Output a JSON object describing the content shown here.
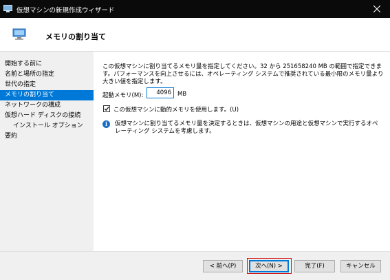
{
  "window": {
    "title": "仮想マシンの新規作成ウィザード"
  },
  "header": {
    "title": "メモリの割り当て"
  },
  "sidebar": {
    "items": [
      {
        "label": "開始する前に"
      },
      {
        "label": "名前と場所の指定"
      },
      {
        "label": "世代の指定"
      },
      {
        "label": "メモリの割り当て",
        "active": true
      },
      {
        "label": "ネットワークの構成"
      },
      {
        "label": "仮想ハード ディスクの接続"
      },
      {
        "label": "インストール オプション",
        "sub": true
      },
      {
        "label": "要約"
      }
    ]
  },
  "main": {
    "description": "この仮想マシンに割り当てるメモリ量を指定してください。32 から 251658240 MB の範囲で指定できます。パフォーマンスを向上させるには、オペレーティング システムで推奨されている最小限のメモリ量より大きい値を指定します。",
    "startup_memory_label": "起動メモリ(M):",
    "startup_memory_value": "4096",
    "startup_memory_unit": "MB",
    "dynamic_memory_checked": true,
    "dynamic_memory_label": "この仮想マシンに動的メモリを使用します。(U)",
    "info_text": "仮想マシンに割り当てるメモリ量を決定するときは、仮想マシンの用途と仮想マシンで実行するオペレーティング システムを考慮します。"
  },
  "footer": {
    "back_label": "< 前へ(P)",
    "next_label": "次へ(N) >",
    "finish_label": "完了(F)",
    "cancel_label": "キャンセル"
  },
  "colors": {
    "accent": "#0078d7",
    "titlebar": "#0a0a0a",
    "highlight_border": "#d21010"
  }
}
